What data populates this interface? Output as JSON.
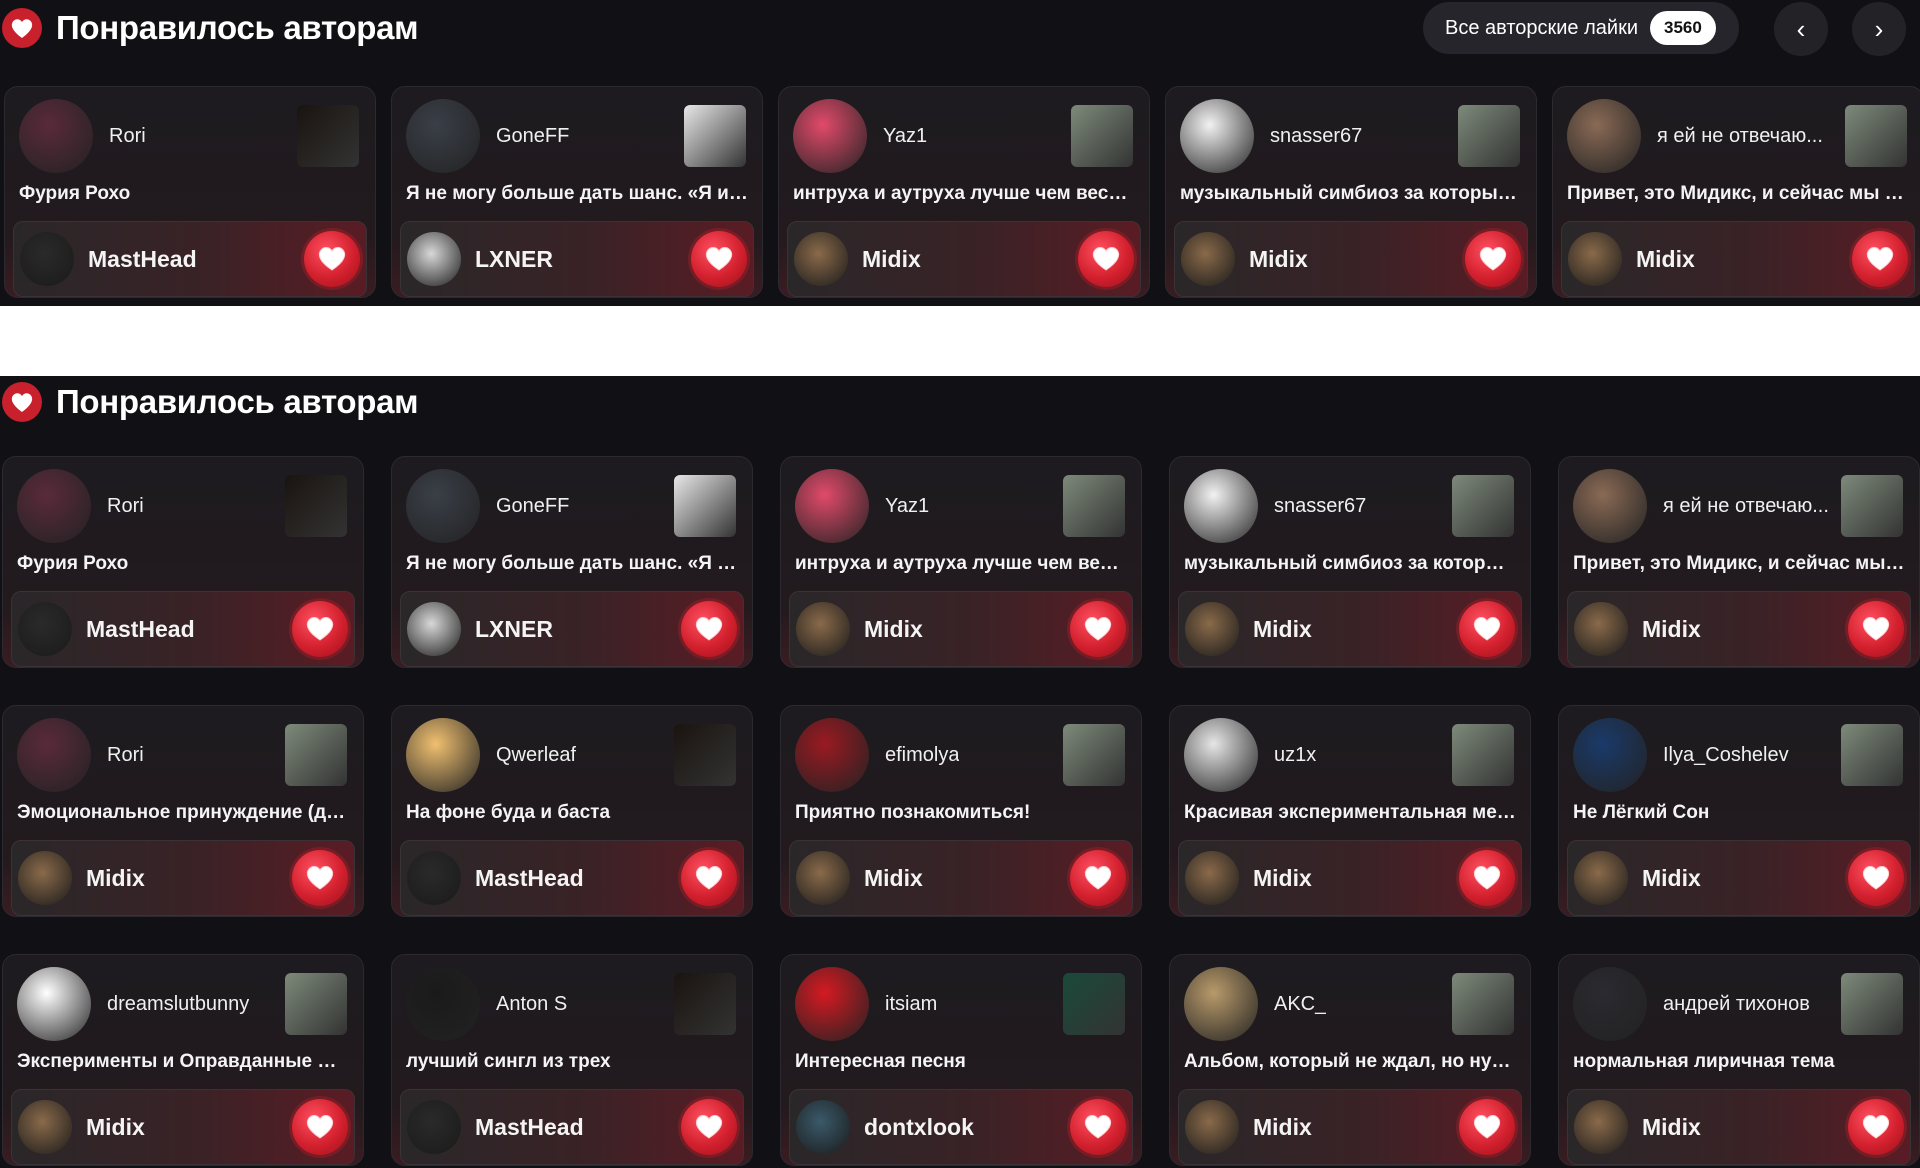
{
  "header": {
    "title": "Понравилось авторам",
    "all_likes_label": "Все авторские лайки",
    "all_likes_count": "3560",
    "prev_label": "‹",
    "next_label": "›"
  },
  "colors": {
    "accent": "#d3202e",
    "background": "#111014"
  },
  "top_row": [
    {
      "author": "Rori",
      "title": "Фурия Рохо",
      "liker": "MastHead",
      "av": "#5a2a3a",
      "cov": "#1a1410",
      "la": "#2a2a2a"
    },
    {
      "author": "GoneFF",
      "title": "Я не могу больше дать шанс. «Я из…",
      "liker": "LXNER",
      "av": "#3a3f48",
      "cov": "#e8e8e8",
      "la": "#d8d8d8"
    },
    {
      "author": "Yaz1",
      "title": "интруха и аутруха лучше чем весь …",
      "liker": "Midix",
      "av": "#e14a6a",
      "cov": "#7d8a7a",
      "la": "#8a6a4a"
    },
    {
      "author": "snasser67",
      "title": "музыкальный симбиоз за который …",
      "liker": "Midix",
      "av": "#f2f2f2",
      "cov": "#7d8a7a",
      "la": "#8a6a4a"
    },
    {
      "author": "я ей не отвечаю...",
      "title": "Привет, это Мидикс, и сейчас мы з…",
      "liker": "Midix",
      "av": "#8a6a55",
      "cov": "#7d8a7a",
      "la": "#8a6a4a"
    }
  ],
  "grid": [
    {
      "author": "Rori",
      "title": "Фурия Рохо",
      "liker": "MastHead",
      "av": "#5a2a3a",
      "cov": "#1a1410",
      "la": "#2a2a2a"
    },
    {
      "author": "GoneFF",
      "title": "Я не могу больше дать шанс. «Я и…",
      "liker": "LXNER",
      "av": "#3a3f48",
      "cov": "#e8e8e8",
      "la": "#d8d8d8"
    },
    {
      "author": "Yaz1",
      "title": "интруха и аутруха лучше чем вес…",
      "liker": "Midix",
      "av": "#e14a6a",
      "cov": "#7d8a7a",
      "la": "#8a6a4a"
    },
    {
      "author": "snasser67",
      "title": "музыкальный симбиоз за которы…",
      "liker": "Midix",
      "av": "#f2f2f2",
      "cov": "#7d8a7a",
      "la": "#8a6a4a"
    },
    {
      "author": "я ей не отвечаю...",
      "title": "Привет, это Мидикс, и сейчас мы…",
      "liker": "Midix",
      "av": "#8a6a55",
      "cov": "#7d8a7a",
      "la": "#8a6a4a"
    },
    {
      "author": "Rori",
      "title": "Эмоциональное принуждение (д…",
      "liker": "Midix",
      "av": "#5a2a3a",
      "cov": "#7d8a7a",
      "la": "#8a6a4a"
    },
    {
      "author": "Qwerleaf",
      "title": "На фоне буда и баста",
      "liker": "MastHead",
      "av": "#f0c070",
      "cov": "#1a1410",
      "la": "#2a2a2a"
    },
    {
      "author": "efimolya",
      "title": "Приятно познакомиться!",
      "liker": "Midix",
      "av": "#9a1a22",
      "cov": "#7d8a7a",
      "la": "#8a6a4a"
    },
    {
      "author": "uz1x",
      "title": "Красивая экспериментальная ме…",
      "liker": "Midix",
      "av": "#e6e6e6",
      "cov": "#7d8a7a",
      "la": "#8a6a4a"
    },
    {
      "author": "Ilya_Coshelev",
      "title": "Не Лёгкий Сон",
      "liker": "Midix",
      "av": "#1a3a6a",
      "cov": "#7d8a7a",
      "la": "#8a6a4a"
    },
    {
      "author": "dreamslutbunny",
      "title": "Эксперименты и Оправданные О…",
      "liker": "Midix",
      "av": "#ffffff",
      "cov": "#7d8a7a",
      "la": "#8a6a4a"
    },
    {
      "author": "Anton S",
      "title": "лучший сингл из трех",
      "liker": "MastHead",
      "av": "#1a1a1a",
      "cov": "#1a1410",
      "la": "#2a2a2a"
    },
    {
      "author": "itsiam",
      "title": "Интересная песня",
      "liker": "dontxlook",
      "av": "#d41a22",
      "cov": "#1a4a3a",
      "la": "#3a5a6a"
    },
    {
      "author": "AKC_",
      "title": "Альбом, который не ждал, но ну…",
      "liker": "Midix",
      "av": "#b89a6a",
      "cov": "#7d8a7a",
      "la": "#8a6a4a"
    },
    {
      "author": "андрей тихонов",
      "title": "нормальная лиричная тема",
      "liker": "Midix",
      "av": "#2a2a30",
      "cov": "#7d8a7a",
      "la": "#8a6a4a"
    }
  ]
}
